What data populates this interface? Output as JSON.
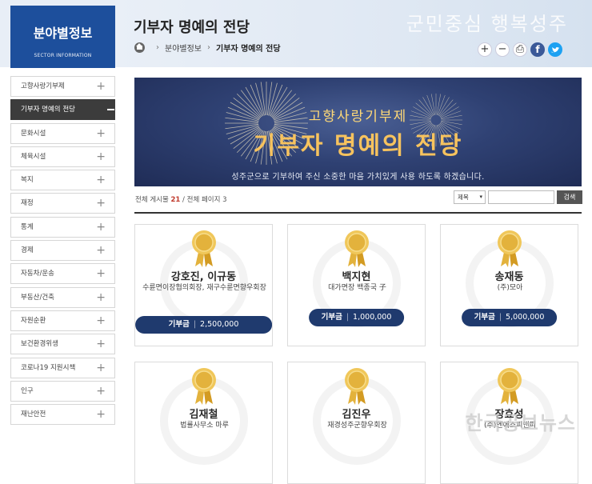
{
  "header": {
    "brand_title": "분야별정보",
    "brand_sub": "SECTOR INFORMATION",
    "page_title": "기부자 명예의 전당",
    "slogan": "군민중심 행복성주",
    "breadcrumb": [
      "분야별정보",
      "기부자 명예의 전당"
    ],
    "tools": {
      "zoom_in": "+",
      "zoom_out": "−",
      "print": "⎙",
      "facebook": "f",
      "twitter": "t"
    }
  },
  "sidebar": {
    "items": [
      {
        "label": "고향사랑기부제",
        "active": false
      },
      {
        "label": "기부자 명예의 전당",
        "active": true
      },
      {
        "label": "문화시설",
        "active": false
      },
      {
        "label": "체육시설",
        "active": false
      },
      {
        "label": "복지",
        "active": false
      },
      {
        "label": "재정",
        "active": false
      },
      {
        "label": "통계",
        "active": false
      },
      {
        "label": "경제",
        "active": false
      },
      {
        "label": "자동차/운송",
        "active": false
      },
      {
        "label": "부동산/건축",
        "active": false
      },
      {
        "label": "자원순환",
        "active": false
      },
      {
        "label": "보건환경위생",
        "active": false
      },
      {
        "label": "코로나19 지원시책",
        "active": false
      },
      {
        "label": "인구",
        "active": false
      },
      {
        "label": "재난안전",
        "active": false
      }
    ]
  },
  "banner": {
    "title_small": "고향사랑기부제",
    "title_large": "기부자 명예의 전당",
    "subtitle": "성주군으로 기부하여 주신 소중한 마음 가치있게 사용 하도록 하겠습니다."
  },
  "list": {
    "count_prefix": "전체 게시물 ",
    "count_total": "21",
    "count_suffix": " / 전체 페이지 3",
    "search_select": "제목",
    "search_placeholder": "",
    "search_button": "검색"
  },
  "cards": [
    {
      "name": "강호진, 이규동",
      "org": "수륜면이장협의회장, 재구수륜면향우회장",
      "amount_label": "기부금",
      "amount": "2,500,000"
    },
    {
      "name": "백지현",
      "org": "대가면장 백종국 子",
      "amount_label": "기부금",
      "amount": "1,000,000"
    },
    {
      "name": "송재동",
      "org": "(주)모아",
      "amount_label": "기부금",
      "amount": "5,000,000"
    },
    {
      "name": "김재철",
      "org": "법률사무소 마루",
      "amount_label": "",
      "amount": ""
    },
    {
      "name": "김진우",
      "org": "재경성주군향우회장",
      "amount_label": "",
      "amount": ""
    },
    {
      "name": "장효성",
      "org": "(주)엔에스피앤피",
      "amount_label": "",
      "amount": ""
    }
  ],
  "watermark": "한국공보뉴스",
  "colors": {
    "brand": "#1d4f9c",
    "pill": "#1f3a6e",
    "gold": "#e3b23c",
    "count_accent": "#c0392b"
  }
}
